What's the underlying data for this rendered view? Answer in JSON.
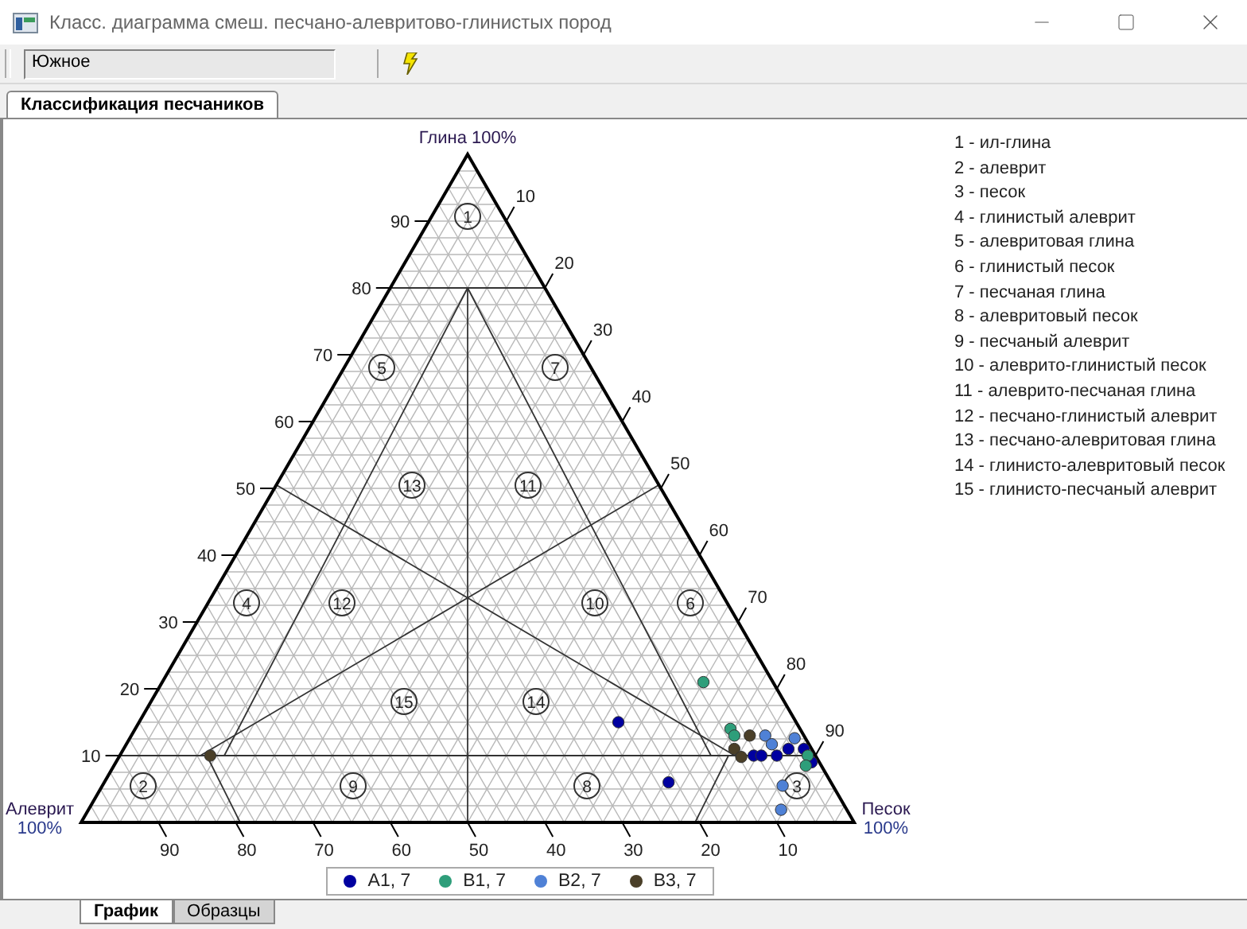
{
  "window": {
    "title": "Класс. диаграмма смеш. песчано-алевритово-глинистых пород"
  },
  "toolbar": {
    "field_value": "Южное"
  },
  "top_tabs": [
    {
      "label": "Классификация песчаников",
      "selected": true
    }
  ],
  "diagram": {
    "apex_label": "Глина 100%",
    "left_label": "Алеврит",
    "left_percent": "100%",
    "right_label": "Песок",
    "right_percent": "100%",
    "left_ticks": [
      "90",
      "80",
      "70",
      "60",
      "50",
      "40",
      "30",
      "20",
      "10"
    ],
    "right_ticks": [
      "10",
      "20",
      "30",
      "40",
      "50",
      "60",
      "70",
      "80",
      "90"
    ],
    "bottom_ticks": [
      "90",
      "80",
      "70",
      "60",
      "50",
      "40",
      "30",
      "20",
      "10"
    ],
    "regions": [
      "1",
      "5",
      "7",
      "13",
      "11",
      "4",
      "12",
      "10",
      "6",
      "15",
      "14",
      "2",
      "9",
      "8",
      "3"
    ],
    "series": [
      {
        "name": "A1, 7",
        "color": "#0000a0"
      },
      {
        "name": "B1, 7",
        "color": "#2e9e7a"
      },
      {
        "name": "B2, 7",
        "color": "#4f81d6"
      },
      {
        "name": "B3, 7",
        "color": "#4a3f28"
      }
    ]
  },
  "classification": [
    "1 - ил-глина",
    "2 - алеврит",
    "3 - песок",
    "4 - глинистый алеврит",
    "5 - алевритовая глина",
    "6 - глинистый песок",
    "7 - песчаная глина",
    "8 - алевритовый песок",
    "9 - песчаный алеврит",
    "10 - алеврито-глинистый песок",
    "11 - алеврито-песчаная глина",
    "12 - песчано-глинистый алеврит",
    "13 - песчано-алевритовая глина",
    "14 - глинисто-алевритовый песок",
    "15 - глинисто-песчаный алеврит"
  ],
  "bottom_tabs": [
    {
      "label": "График",
      "selected": true
    },
    {
      "label": "Образцы",
      "selected": false
    }
  ]
}
